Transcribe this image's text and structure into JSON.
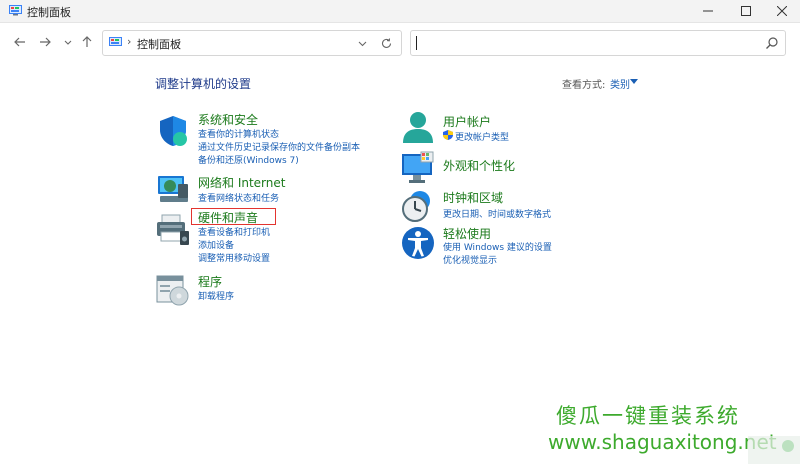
{
  "window": {
    "title": "控制面板",
    "icon": "control-panel-icon"
  },
  "nav": {
    "breadcrumb_sep": "›",
    "address_text": "控制面板",
    "search_placeholder": ""
  },
  "header": {
    "title": "调整计算机的设置",
    "view_by_label": "查看方式:",
    "view_by_value": "类别"
  },
  "categories": {
    "system": {
      "title": "系统和安全",
      "icon": "shield-icon",
      "links": [
        "查看你的计算机状态",
        "通过文件历史记录保存你的文件备份副本",
        "备份和还原(Windows 7)"
      ]
    },
    "network": {
      "title": "网络和 Internet",
      "icon": "network-icon",
      "links": [
        "查看网络状态和任务"
      ]
    },
    "hardware": {
      "title": "硬件和声音",
      "icon": "printer-icon",
      "links": [
        "查看设备和打印机",
        "添加设备",
        "调整常用移动设置"
      ]
    },
    "programs": {
      "title": "程序",
      "icon": "programs-icon",
      "links": [
        "卸载程序"
      ]
    },
    "user": {
      "title": "用户帐户",
      "icon": "user-icon",
      "links": [
        "更改帐户类型"
      ]
    },
    "appearance": {
      "title": "外观和个性化",
      "icon": "monitor-icon",
      "links": []
    },
    "clock": {
      "title": "时钟和区域",
      "icon": "clock-icon",
      "links": [
        "更改日期、时间或数字格式"
      ]
    },
    "ease": {
      "title": "轻松使用",
      "icon": "accessibility-icon",
      "links": [
        "使用 Windows 建议的设置",
        "优化视觉显示"
      ]
    }
  },
  "watermark": {
    "text": "傻瓜一键重装系统",
    "url": "www.shaguaxitong.net"
  },
  "colors": {
    "title_green": "#1b7a1b",
    "link_blue": "#1a5fb4",
    "highlight_red": "#e3342f",
    "watermark_green": "#3daa2d"
  }
}
